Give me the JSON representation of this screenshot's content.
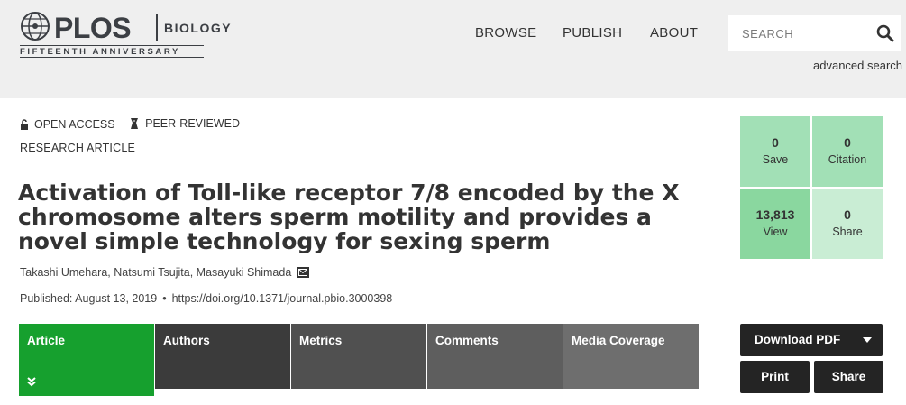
{
  "header": {
    "logo": "PLOS",
    "journal": "BIOLOGY",
    "anniversary": "FIFTEENTH ANNIVERSARY",
    "nav": [
      "BROWSE",
      "PUBLISH",
      "ABOUT"
    ],
    "search_placeholder": "SEARCH",
    "advanced_search": "advanced search"
  },
  "article": {
    "open_access": "OPEN ACCESS",
    "peer_reviewed": "PEER-REVIEWED",
    "type": "RESEARCH ARTICLE",
    "title": "Activation of Toll-like receptor 7/8 encoded by the X chromosome alters sperm motility and provides a novel simple technology for sexing sperm",
    "authors": "Takashi Umehara, Natsumi Tsujita, Masayuki Shimada",
    "published": "Published: August 13, 2019",
    "doi": "https://doi.org/10.1371/journal.pbio.3000398"
  },
  "tabs": [
    "Article",
    "Authors",
    "Metrics",
    "Comments",
    "Media Coverage"
  ],
  "metrics": {
    "save": {
      "value": "0",
      "label": "Save"
    },
    "citation": {
      "value": "0",
      "label": "Citation"
    },
    "view": {
      "value": "13,813",
      "label": "View"
    },
    "share": {
      "value": "0",
      "label": "Share"
    }
  },
  "actions": {
    "download": "Download PDF",
    "print": "Print",
    "share": "Share"
  },
  "colors": {
    "header_bg": "#efefef",
    "tab_active": "#16a02e",
    "metric_green": "#a2e0b6",
    "button_dark": "#242424"
  },
  "icons": [
    "globe-icon",
    "lock-icon",
    "peer-review-icon",
    "search-icon",
    "mail-icon",
    "chevron-down-icon",
    "caret-down-icon"
  ]
}
